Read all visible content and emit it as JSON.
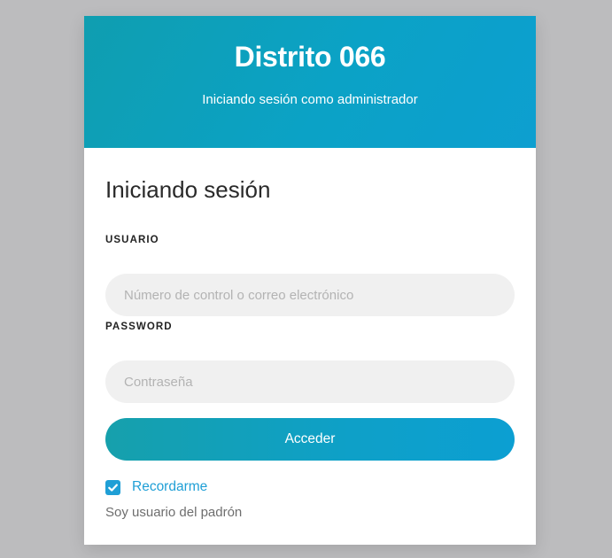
{
  "header": {
    "title": "Distrito 066",
    "subtitle": "Iniciando sesión como administrador"
  },
  "form": {
    "title": "Iniciando sesión",
    "user_label": "USUARIO",
    "user_placeholder": "Número de control o correo electrónico",
    "user_value": "",
    "password_label": "PASSWORD",
    "password_placeholder": "Contraseña",
    "password_value": "",
    "submit_label": "Acceder",
    "remember_label": "Recordarme",
    "remember_checked": true,
    "padron_link": "Soy usuario del padrón"
  },
  "colors": {
    "page_background": "#bcbcbe",
    "header_gradient_start": "#0f9eb0",
    "header_gradient_end": "#0d9fd0",
    "accent": "#1f9fd6",
    "input_background": "#f0f0f0"
  },
  "icons": {
    "remember_checkbox": "checkmark-icon"
  }
}
